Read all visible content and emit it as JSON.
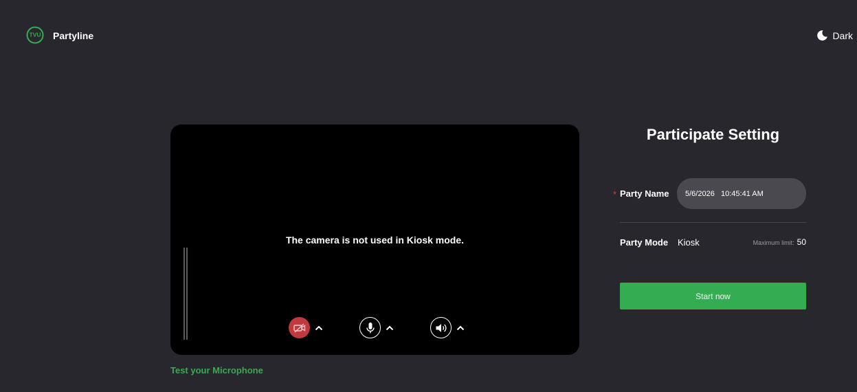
{
  "app": {
    "brand": "Partyline",
    "logo_text": "TVU",
    "theme_label": "Dark",
    "theme_icon": "moon-icon"
  },
  "preview": {
    "message": "The camera is not used in Kiosk mode.",
    "controls": [
      {
        "name": "camera",
        "icon": "camera-off-icon",
        "state": "off"
      },
      {
        "name": "microphone",
        "icon": "microphone-icon",
        "state": "on"
      },
      {
        "name": "speaker",
        "icon": "speaker-icon",
        "state": "on"
      }
    ],
    "test_microphone_label": "Test your Microphone"
  },
  "settings": {
    "title": "Participate Setting",
    "party_name_label": "Party Name",
    "required_mark": "*",
    "party_name_value": "5/6/2026   10:45:41 AM",
    "party_mode_label": "Party Mode",
    "party_mode_value": "Kiosk",
    "max_limit_label": "Maximum limit:",
    "max_limit_value": "50",
    "start_button_label": "Start now"
  },
  "colors": {
    "background": "#28272e",
    "accent_green": "#34ad52",
    "camera_off_red": "#c0393f",
    "input_bg": "#4a494f"
  }
}
